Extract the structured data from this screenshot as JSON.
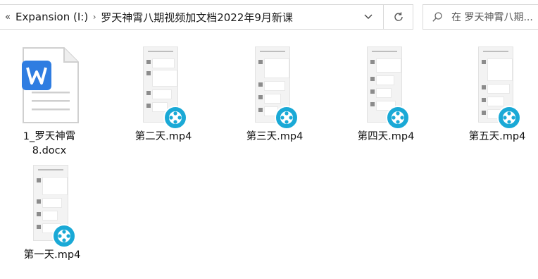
{
  "breadcrumb": {
    "overflow_icon": "double-chevron-left-icon",
    "drive": "Expansion (I:)",
    "folder": "罗天神霄八期视频加文档2022年9月新课"
  },
  "search": {
    "placeholder": "在 罗天神霄八期..."
  },
  "icons": {
    "refresh": "refresh-icon",
    "search": "search-icon",
    "dropdown": "chevron-down-icon"
  },
  "files": [
    {
      "name": "1_罗天神霄8.docx",
      "line1": "1_罗天神霄",
      "line2": "8.docx",
      "type": "docx"
    },
    {
      "name": "第二天.mp4",
      "type": "mp4"
    },
    {
      "name": "第三天.mp4",
      "type": "mp4"
    },
    {
      "name": "第四天.mp4",
      "type": "mp4"
    },
    {
      "name": "第五天.mp4",
      "type": "mp4"
    },
    {
      "name": "第一天.mp4",
      "type": "mp4"
    }
  ],
  "colors": {
    "word_blue": "#2f7de1",
    "video_badge": "#1aa9d6"
  }
}
